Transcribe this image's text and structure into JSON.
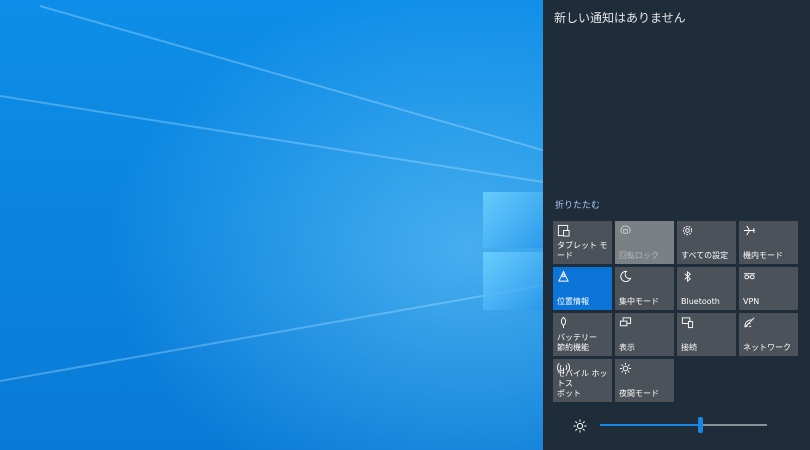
{
  "action_center": {
    "no_notifications": "新しい通知はありません",
    "collapse_label": "折りたたむ",
    "tiles": [
      {
        "label": "タブレット モード",
        "icon": "tablet-mode-icon",
        "state": "normal"
      },
      {
        "label": "回転ロック",
        "icon": "rotation-lock-icon",
        "state": "disabled"
      },
      {
        "label": "すべての設定",
        "icon": "gear-icon",
        "state": "normal"
      },
      {
        "label": "機内モード",
        "icon": "airplane-icon",
        "state": "normal"
      },
      {
        "label": "位置情報",
        "icon": "location-icon",
        "state": "active"
      },
      {
        "label": "集中モード",
        "icon": "moon-icon",
        "state": "normal"
      },
      {
        "label": "Bluetooth",
        "icon": "bluetooth-icon",
        "state": "normal"
      },
      {
        "label": "VPN",
        "icon": "vpn-icon",
        "state": "normal"
      },
      {
        "label": "バッテリー\n節約機能",
        "icon": "battery-saver-icon",
        "state": "normal"
      },
      {
        "label": "表示",
        "icon": "project-display-icon",
        "state": "normal"
      },
      {
        "label": "接続",
        "icon": "connect-icon",
        "state": "normal"
      },
      {
        "label": "ネットワーク",
        "icon": "network-icon",
        "state": "normal"
      },
      {
        "label": "モバイル ホットス\nポット",
        "icon": "mobile-hotspot-icon",
        "state": "normal"
      },
      {
        "label": "夜間モード",
        "icon": "night-light-icon",
        "state": "normal"
      }
    ],
    "brightness": {
      "icon": "sun-icon",
      "level": 0.6
    }
  },
  "colors": {
    "panel_bg": "#1f2c3a",
    "tile_bg": "#4c5259",
    "tile_active": "#0c74d6",
    "accent": "#1786e6"
  }
}
